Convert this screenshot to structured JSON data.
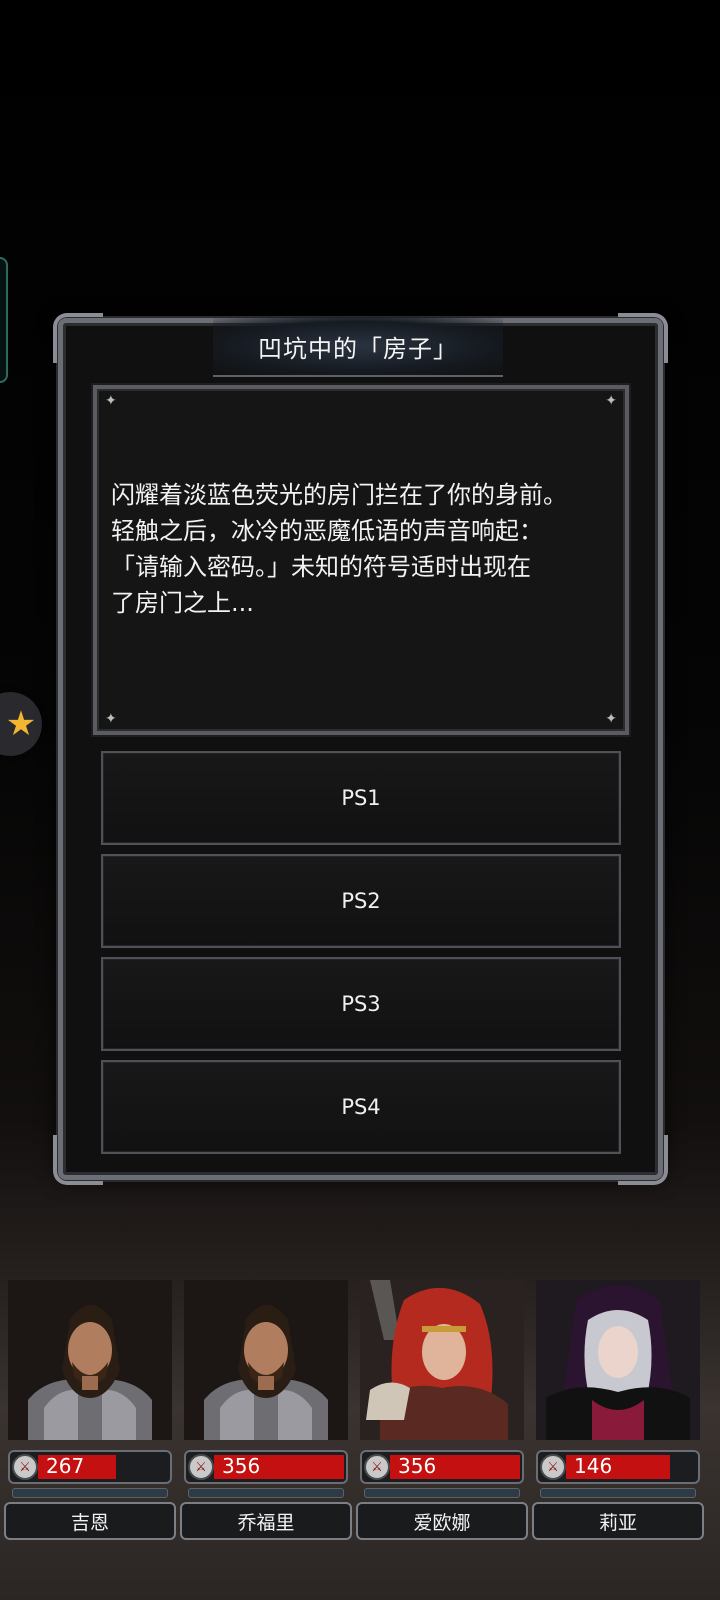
{
  "event": {
    "title": "凹坑中的「房子」",
    "story_lines": [
      "闪耀着淡蓝色荧光的房门拦在了你的身前。",
      "轻触之后，冰冷的恶魔低语的声音响起：",
      "「请输入密码。」未知的符号适时出现在",
      "了房门之上..."
    ],
    "choices": [
      {
        "label": "PS1"
      },
      {
        "label": "PS2"
      },
      {
        "label": "PS3"
      },
      {
        "label": "PS4"
      }
    ]
  },
  "party": [
    {
      "name": "吉恩",
      "hp": "267",
      "hp_fraction": 0.6,
      "portrait": "knight"
    },
    {
      "name": "乔福里",
      "hp": "356",
      "hp_fraction": 1.0,
      "portrait": "knight"
    },
    {
      "name": "爱欧娜",
      "hp": "356",
      "hp_fraction": 1.0,
      "portrait": "red-haired-warrior"
    },
    {
      "name": "莉亚",
      "hp": "146",
      "hp_fraction": 0.8,
      "portrait": "hooded-sorceress"
    }
  ],
  "icons": {
    "hp": "sword-icon",
    "floating": "star-icon"
  },
  "colors": {
    "hp_bar": "#c41010",
    "frame": "#6b6e75",
    "side_tab": "#2f6b5c",
    "star": "#f2b632"
  }
}
